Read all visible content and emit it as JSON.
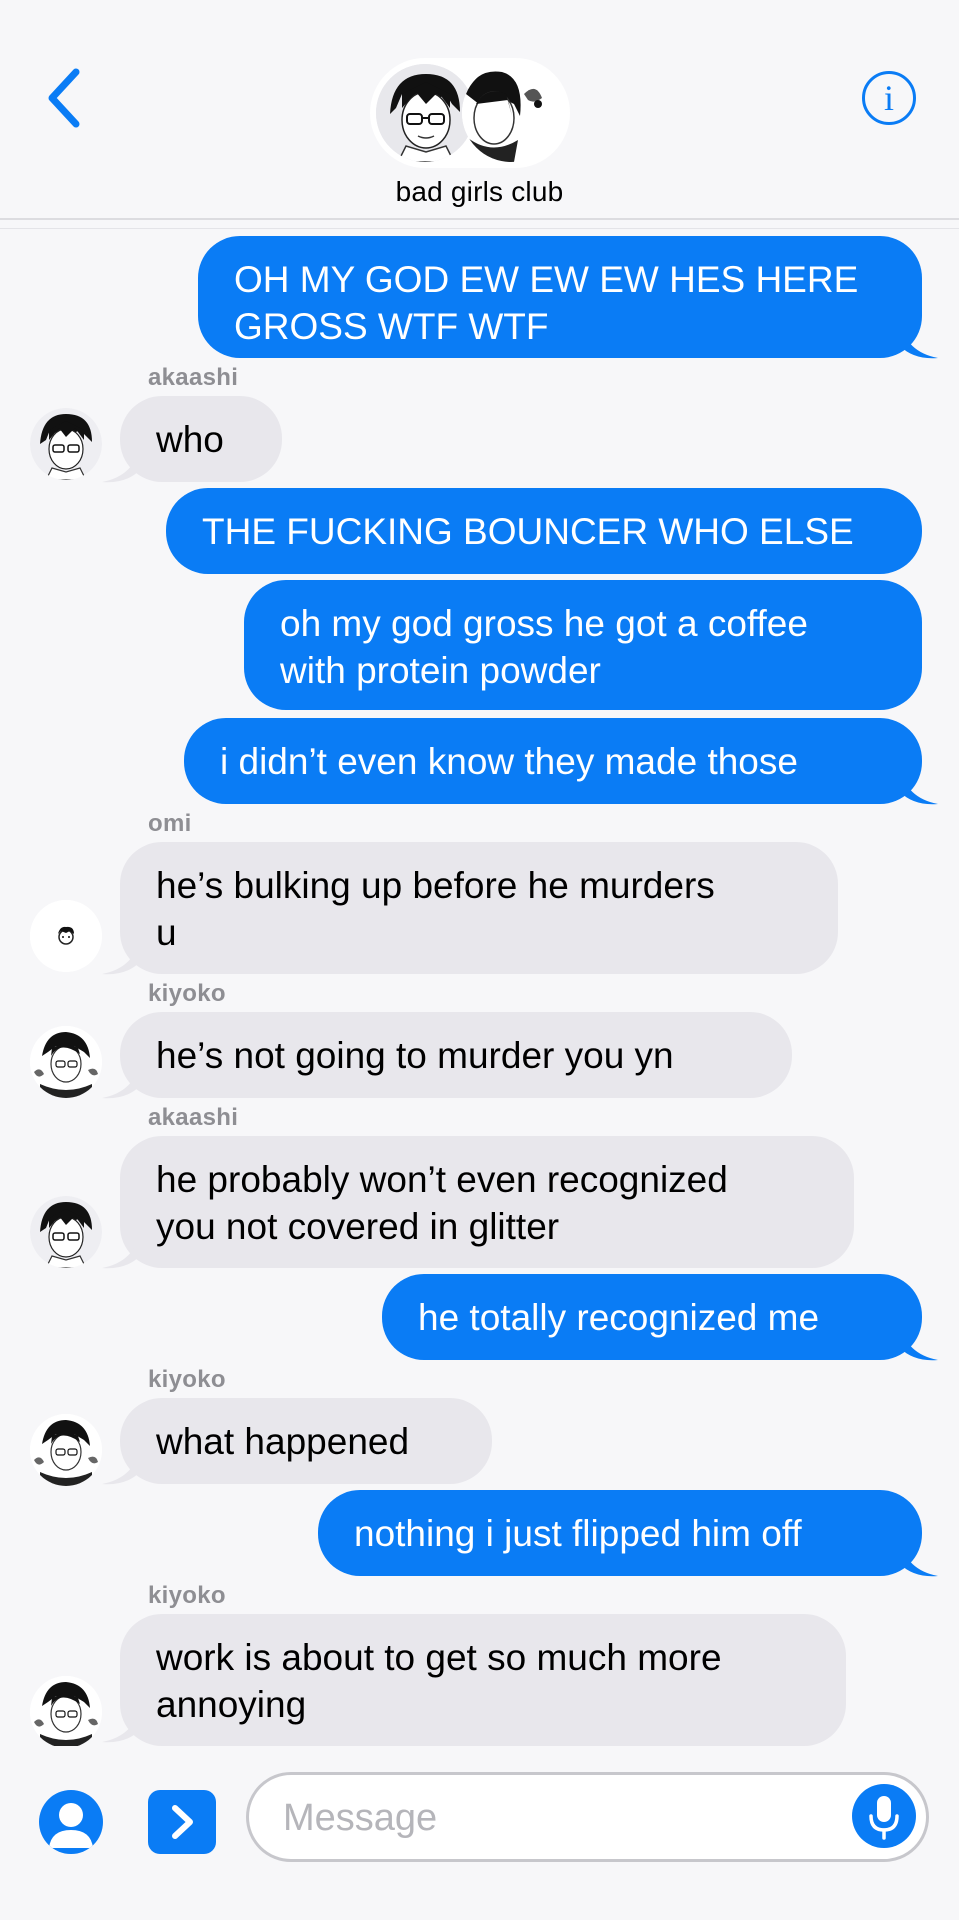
{
  "header": {
    "title": "bad girls club",
    "back_icon": "chevron-left-icon",
    "info_icon": "info-icon",
    "info_glyph": "i",
    "accent": "#0a7cf5"
  },
  "messages": [
    {
      "type": "sent",
      "text": "OH MY GOD EW EW EW HES HERE\nGROSS WTF WTF"
    },
    {
      "type": "recv",
      "sender": "akaashi",
      "text": "who"
    },
    {
      "type": "sent",
      "text": "THE FUCKING BOUNCER WHO ELSE"
    },
    {
      "type": "sent",
      "text": "oh my god gross he got a coffee\nwith protein powder"
    },
    {
      "type": "sent",
      "text": "i didn’t even know they made those"
    },
    {
      "type": "recv",
      "sender": "omi",
      "text": "he’s bulking up before he murders\nu"
    },
    {
      "type": "recv",
      "sender": "kiyoko",
      "text": "he’s not going to murder you yn"
    },
    {
      "type": "recv",
      "sender": "akaashi",
      "text": "he probably won’t even recognized\nyou not covered in glitter"
    },
    {
      "type": "sent",
      "text": "he totally recognized me"
    },
    {
      "type": "recv",
      "sender": "kiyoko",
      "text": "what happened"
    },
    {
      "type": "sent",
      "text": "nothing i just flipped him off"
    },
    {
      "type": "recv",
      "sender": "kiyoko",
      "text": "work is about to get so much more\nannoying"
    }
  ],
  "input": {
    "placeholder": "Message",
    "value": "",
    "contact_icon": "person-icon",
    "apps_icon": "chevron-right-icon",
    "mic_icon": "microphone-icon"
  },
  "colors": {
    "sent_bubble": "#0a7cf5",
    "received_bubble": "#e8e7ec",
    "sender_name": "#8e8e93",
    "background": "#f7f7f9"
  }
}
